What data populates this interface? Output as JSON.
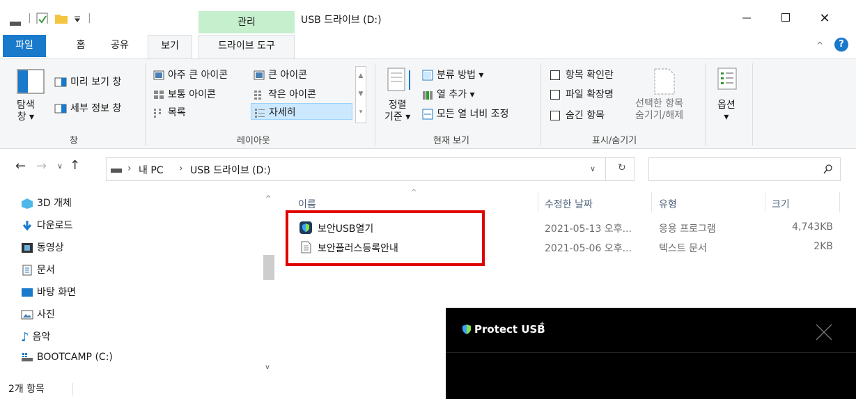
{
  "titlebar": {
    "manage_label": "관리",
    "window_title": "USB 드라이브 (D:)",
    "minimize_icon": "minimize-icon",
    "maximize_icon": "maximize-icon",
    "close_glyph": "✕"
  },
  "tabs": {
    "file": "파일",
    "home": "홈",
    "share": "공유",
    "view": "보기",
    "drive_tools": "드라이브 도구"
  },
  "ribbon": {
    "pane": {
      "nav_pane_label": "탐색\n창 ▾",
      "preview_pane": "미리 보기 창",
      "details_pane": "세부 정보 창",
      "group_label": "창"
    },
    "layout": {
      "extra_large": "아주 큰 아이콘",
      "large": "큰 아이콘",
      "medium": "보통 아이콘",
      "small": "작은 아이콘",
      "list": "목록",
      "details": "자세히",
      "group_label": "레이아웃"
    },
    "current_view": {
      "sort_label": "정렬\n기준 ▾",
      "group_by": "분류 방법 ▾",
      "add_column": "열 추가 ▾",
      "size_all_columns": "모든 열 너비 조정",
      "group_label": "현재 보기"
    },
    "show_hide": {
      "item_checkboxes": "항목 확인란",
      "file_extensions": "파일 확장명",
      "hidden_items": "숨긴 항목",
      "hide_selected": "선택한 항목\n숨기기/해제",
      "group_label": "표시/숨기기"
    },
    "options": {
      "label": "옵션\n▾"
    }
  },
  "address": {
    "path_pc": "내 PC",
    "path_drive": "USB 드라이브 (D:)",
    "search_placeholder": ""
  },
  "nav_items": [
    {
      "label": "3D 개체"
    },
    {
      "label": "다운로드"
    },
    {
      "label": "동영상"
    },
    {
      "label": "문서"
    },
    {
      "label": "바탕 화면"
    },
    {
      "label": "사진"
    },
    {
      "label": "음악"
    },
    {
      "label": "BOOTCAMP (C:)"
    }
  ],
  "columns": {
    "name": "이름",
    "modified": "수정한 날짜",
    "type": "유형",
    "size": "크기"
  },
  "files": [
    {
      "name": "보안USB열기",
      "modified": "2021-05-13 오후...",
      "type": "응용 프로그램",
      "size": "4,743KB"
    },
    {
      "name": "보안플러스등록안내",
      "modified": "2021-05-06 오후...",
      "type": "텍스트 문서",
      "size": "2KB"
    }
  ],
  "status": {
    "count": "2개 항목"
  },
  "popup": {
    "title": "Protect USB",
    "superscript": "+"
  },
  "colors": {
    "file_tab": "#1979ca",
    "manage_tab": "#c6efce",
    "highlight_box": "#e00000",
    "ribbon_bg": "#f5f6f7"
  }
}
